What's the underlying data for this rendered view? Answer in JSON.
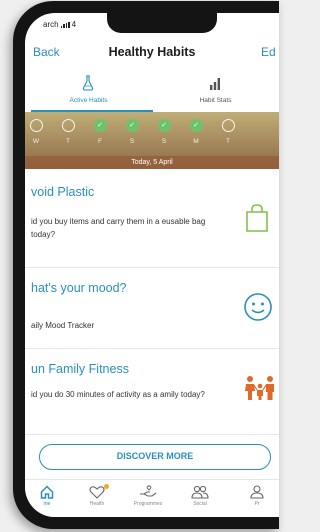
{
  "status_bar": {
    "carrier": "arch",
    "time": "4"
  },
  "navbar": {
    "back": "Back",
    "title": "Healthy Habits",
    "edit": "Ed"
  },
  "tabs": [
    {
      "label": "Active Habits",
      "icon": "flask-icon",
      "active": true
    },
    {
      "label": "Habit Stats",
      "icon": "bar-chart-icon",
      "active": false
    }
  ],
  "week": {
    "days": [
      {
        "letter": "W",
        "done": false
      },
      {
        "letter": "T",
        "done": false
      },
      {
        "letter": "F",
        "done": true
      },
      {
        "letter": "S",
        "done": true
      },
      {
        "letter": "S",
        "done": true
      },
      {
        "letter": "M",
        "done": true
      },
      {
        "letter": "T",
        "done": false
      }
    ],
    "today": "Today, 5 April"
  },
  "cards": [
    {
      "title": "void Plastic",
      "text": "id you buy items and carry them in a eusable bag today?",
      "icon": "shopping-bag-icon"
    },
    {
      "title": "hat's your mood?",
      "text": "aily Mood Tracker",
      "icon": "smiley-icon"
    },
    {
      "title": "un Family Fitness",
      "text": "id you do 30 minutes of activity as a amily today?",
      "icon": "family-icon"
    }
  ],
  "discover_label": "DISCOVER MORE",
  "bottom_tabs": [
    {
      "label": "me",
      "icon": "home-icon",
      "active": true
    },
    {
      "label": "Health",
      "icon": "heart-icon",
      "active": false
    },
    {
      "label": "Programmes",
      "icon": "hand-heart-icon",
      "active": false
    },
    {
      "label": "Social",
      "icon": "people-icon",
      "active": false
    },
    {
      "label": "Pr",
      "icon": "person-icon",
      "active": false
    }
  ],
  "colors": {
    "accent": "#2a8fbd",
    "done_green": "#6cc36a",
    "bag_green": "#7fc24a",
    "family_orange": "#e0682a"
  }
}
